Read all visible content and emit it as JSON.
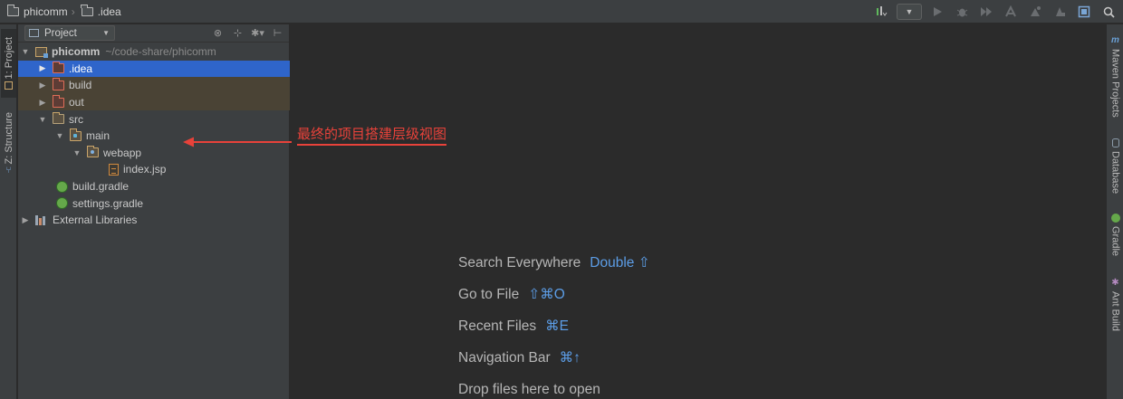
{
  "breadcrumb": {
    "items": [
      {
        "label": "phicomm",
        "icon": "folder-icon"
      },
      {
        "label": ".idea",
        "icon": "folder-icon"
      }
    ],
    "separator": "›"
  },
  "toolbar": {
    "items": [
      {
        "name": "sdk-icon"
      },
      {
        "name": "run-config-combo"
      },
      {
        "name": "run-icon"
      },
      {
        "name": "debug-icon"
      },
      {
        "name": "coverage-icon"
      },
      {
        "name": "profile-icon"
      },
      {
        "name": "attach-icon"
      },
      {
        "name": "stop-icon"
      },
      {
        "name": "project-structure-icon"
      },
      {
        "name": "search-icon"
      }
    ]
  },
  "left_stripe": {
    "tabs": [
      {
        "label": "1: Project",
        "active": true
      },
      {
        "label": "Z: Structure",
        "active": false
      }
    ]
  },
  "project_panel": {
    "view_label": "Project",
    "tree": [
      {
        "label": "phicomm",
        "hint": "~/code-share/phicomm",
        "icon": "module-folder-icon",
        "toggle": "▼",
        "level": 0,
        "state": "normal",
        "bold": true
      },
      {
        "label": ".idea",
        "icon": "folder-icon",
        "toggle": "▶",
        "level": 1,
        "state": "selected"
      },
      {
        "label": "build",
        "icon": "folder-excluded-icon",
        "toggle": "▶",
        "level": 1,
        "state": "excluded"
      },
      {
        "label": "out",
        "icon": "folder-excluded-icon",
        "toggle": "▶",
        "level": 1,
        "state": "excluded"
      },
      {
        "label": "src",
        "icon": "folder-icon",
        "toggle": "▼",
        "level": 1,
        "state": "normal"
      },
      {
        "label": "main",
        "icon": "source-folder-icon",
        "toggle": "▼",
        "level": 2,
        "state": "normal"
      },
      {
        "label": "webapp",
        "icon": "web-folder-icon",
        "toggle": "▼",
        "level": 3,
        "state": "normal"
      },
      {
        "label": "index.jsp",
        "icon": "jsp-file-icon",
        "toggle": "",
        "level": 4,
        "state": "normal"
      },
      {
        "label": "build.gradle",
        "icon": "gradle-icon",
        "toggle": "",
        "level": 1,
        "state": "normal"
      },
      {
        "label": "settings.gradle",
        "icon": "gradle-icon",
        "toggle": "",
        "level": 1,
        "state": "normal"
      },
      {
        "label": "External Libraries",
        "icon": "libraries-icon",
        "toggle": "▶",
        "level": 0,
        "state": "normal"
      }
    ]
  },
  "annotation": {
    "text": "最终的项目搭建层级视图",
    "color": "#e8423a"
  },
  "editor_hints": [
    {
      "label": "Search Everywhere",
      "shortcut": "Double ⇧"
    },
    {
      "label": "Go to File",
      "shortcut": "⇧⌘O"
    },
    {
      "label": "Recent Files",
      "shortcut": "⌘E"
    },
    {
      "label": "Navigation Bar",
      "shortcut": "⌘↑"
    },
    {
      "label": "Drop files here to open",
      "shortcut": ""
    }
  ],
  "right_stripe": {
    "tabs": [
      {
        "label": "Maven Projects",
        "icon": "maven-icon"
      },
      {
        "label": "Database",
        "icon": "database-icon"
      },
      {
        "label": "Gradle",
        "icon": "gradle-icon"
      },
      {
        "label": "Ant Build",
        "icon": "ant-icon"
      }
    ]
  },
  "colors": {
    "selection": "#2f65ca",
    "excluded_row": "#4a4335",
    "shortcut_key": "#5c9de6",
    "panel_bg": "#3c3f41",
    "editor_bg": "#2b2b2b"
  }
}
